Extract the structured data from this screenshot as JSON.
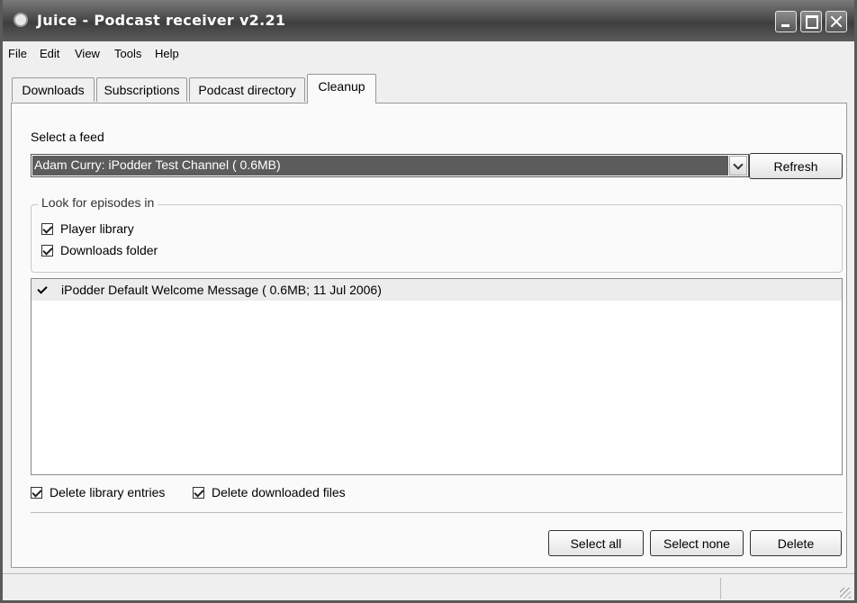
{
  "window": {
    "title": "Juice - Podcast receiver v2.21"
  },
  "menu": [
    "File",
    "Edit",
    "View",
    "Tools",
    "Help"
  ],
  "tabs": [
    {
      "label": "Downloads",
      "active": false
    },
    {
      "label": "Subscriptions",
      "active": false
    },
    {
      "label": "Podcast directory",
      "active": false
    },
    {
      "label": "Cleanup",
      "active": true
    }
  ],
  "cleanup": {
    "select_feed_label": "Select a feed",
    "feed_selected": "Adam Curry: iPodder Test Channel ( 0.6MB)",
    "refresh_label": "Refresh",
    "look_for_label": "Look for episodes in",
    "player_library_label": "Player library",
    "player_library_checked": true,
    "downloads_folder_label": "Downloads folder",
    "downloads_folder_checked": true,
    "episodes": [
      {
        "label": "iPodder Default Welcome Message ( 0.6MB; 11 Jul 2006)",
        "checked": true
      }
    ],
    "delete_library_label": "Delete library entries",
    "delete_library_checked": true,
    "delete_files_label": "Delete downloaded files",
    "delete_files_checked": true,
    "select_all_label": "Select all",
    "select_none_label": "Select none",
    "delete_label": "Delete"
  },
  "icons": {
    "app": "juice-app-icon",
    "minimize": "minimize-icon",
    "maximize": "maximize-icon",
    "close": "close-icon",
    "dropdown": "chevron-down-icon",
    "resize": "resize-grip-icon"
  }
}
